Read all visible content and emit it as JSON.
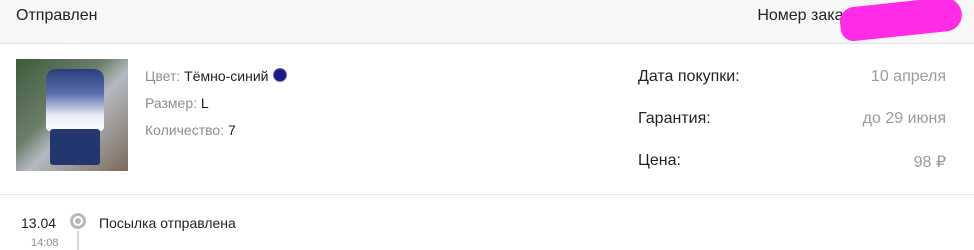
{
  "header": {
    "status": "Отправлен",
    "order_number_label": "Номер заказа:"
  },
  "product": {
    "attributes": [
      {
        "label": "Цвет:",
        "value": "Тёмно-синий",
        "swatch": "#1a1a8a"
      },
      {
        "label": "Размер:",
        "value": "L"
      },
      {
        "label": "Количество:",
        "value": "7"
      }
    ],
    "info": [
      {
        "label": "Дата покупки:",
        "value": "10 апреля"
      },
      {
        "label": "Гарантия:",
        "value": "до 29 июня"
      },
      {
        "label": "Цена:",
        "value": "98 ₽"
      }
    ]
  },
  "timeline": [
    {
      "date": "13.04",
      "time": "14:08",
      "event": "Посылка отправлена"
    }
  ],
  "colors": {
    "header_bg": "#f7f7f8",
    "muted_text": "#9a9aa2",
    "redaction": "#ff2be6"
  }
}
